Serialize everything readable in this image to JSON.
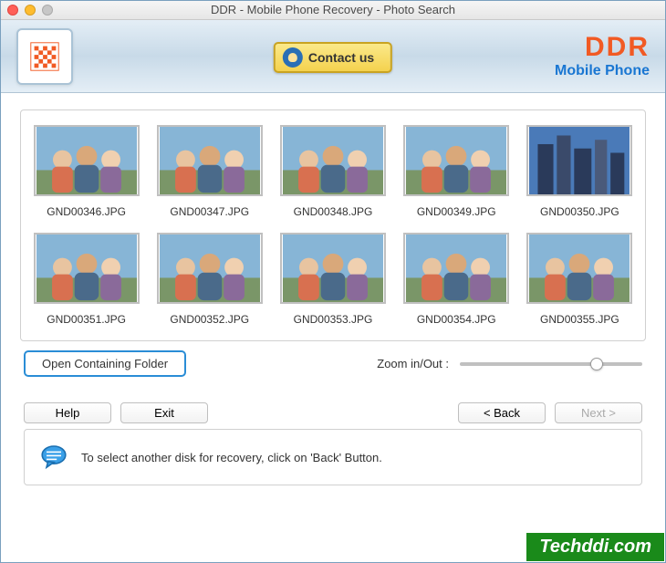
{
  "window": {
    "title": "DDR - Mobile Phone Recovery - Photo Search"
  },
  "header": {
    "contact_label": "Contact us",
    "brand": "DDR",
    "brand_sub": "Mobile Phone"
  },
  "photos": [
    {
      "filename": "GND00346.JPG"
    },
    {
      "filename": "GND00347.JPG"
    },
    {
      "filename": "GND00348.JPG"
    },
    {
      "filename": "GND00349.JPG"
    },
    {
      "filename": "GND00350.JPG"
    },
    {
      "filename": "GND00351.JPG"
    },
    {
      "filename": "GND00352.JPG"
    },
    {
      "filename": "GND00353.JPG"
    },
    {
      "filename": "GND00354.JPG"
    },
    {
      "filename": "GND00355.JPG"
    }
  ],
  "toolbar": {
    "open_folder_label": "Open Containing Folder",
    "zoom_label": "Zoom in/Out :",
    "zoom_value_percent": 75
  },
  "nav": {
    "help": "Help",
    "exit": "Exit",
    "back": "< Back",
    "next": "Next >"
  },
  "info": {
    "text": "To select another disk for recovery, click on 'Back' Button."
  },
  "watermark": "Techddi.com"
}
